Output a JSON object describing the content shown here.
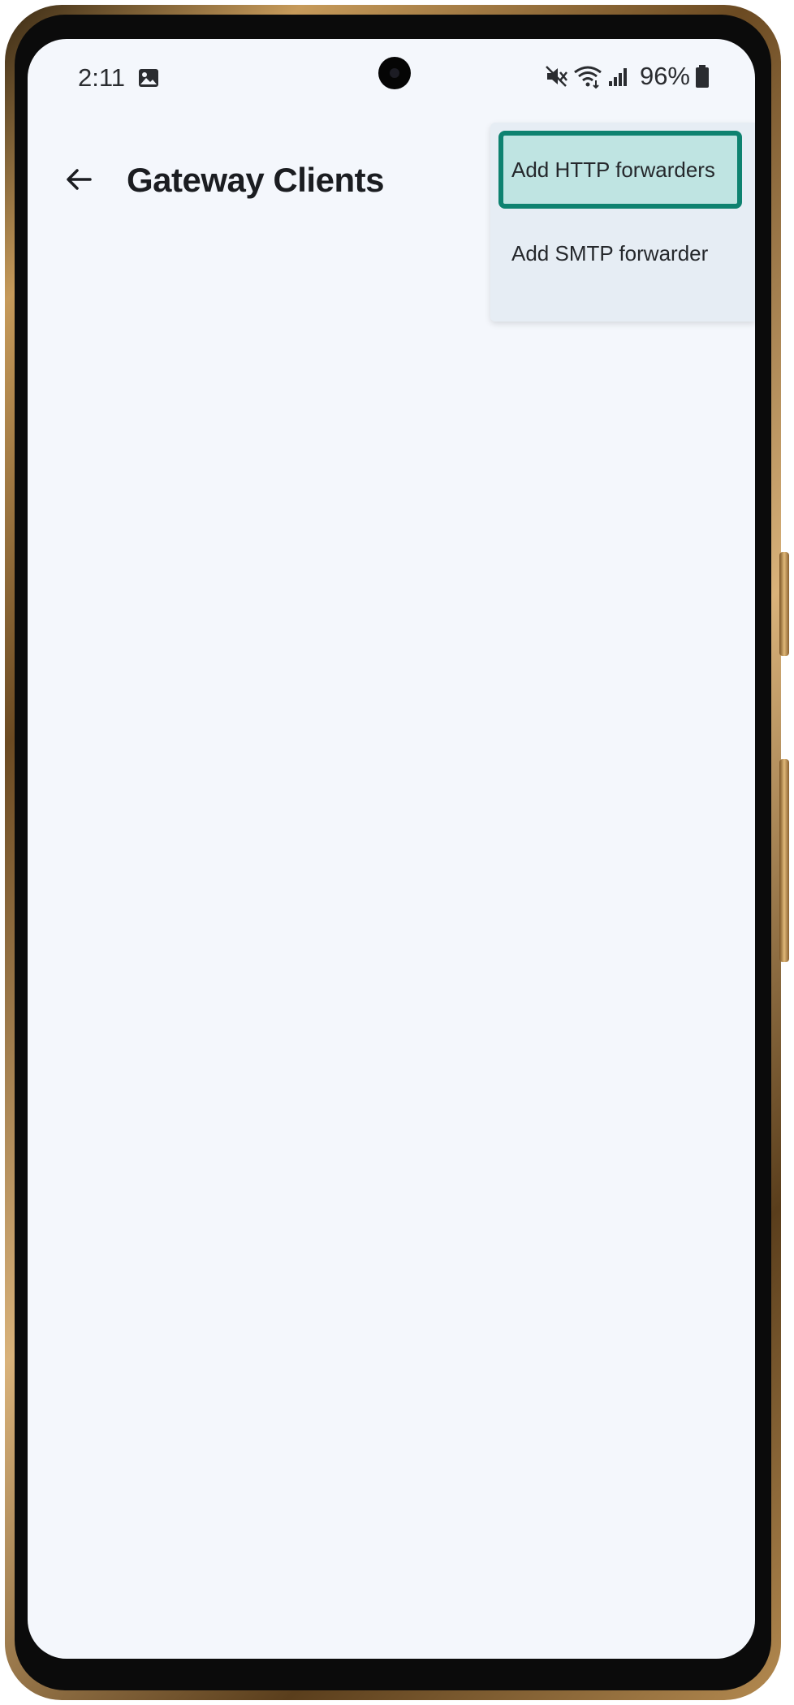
{
  "status_bar": {
    "time": "2:11",
    "battery_percent": "96%",
    "icons": [
      "image-icon",
      "mute-icon",
      "wifi-icon",
      "signal-icon",
      "battery-icon"
    ]
  },
  "app_bar": {
    "back_icon": "arrow-left-icon",
    "title": "Gateway Clients"
  },
  "menu": {
    "items": [
      {
        "label": "Add HTTP forwarders",
        "focused": true
      },
      {
        "label": "Add SMTP forwarder",
        "focused": false
      }
    ]
  },
  "colors": {
    "screen_background": "#f4f7fc",
    "menu_background": "#e6edf4",
    "focus_fill": "#bfe4e2",
    "focus_border": "#0e8270"
  }
}
